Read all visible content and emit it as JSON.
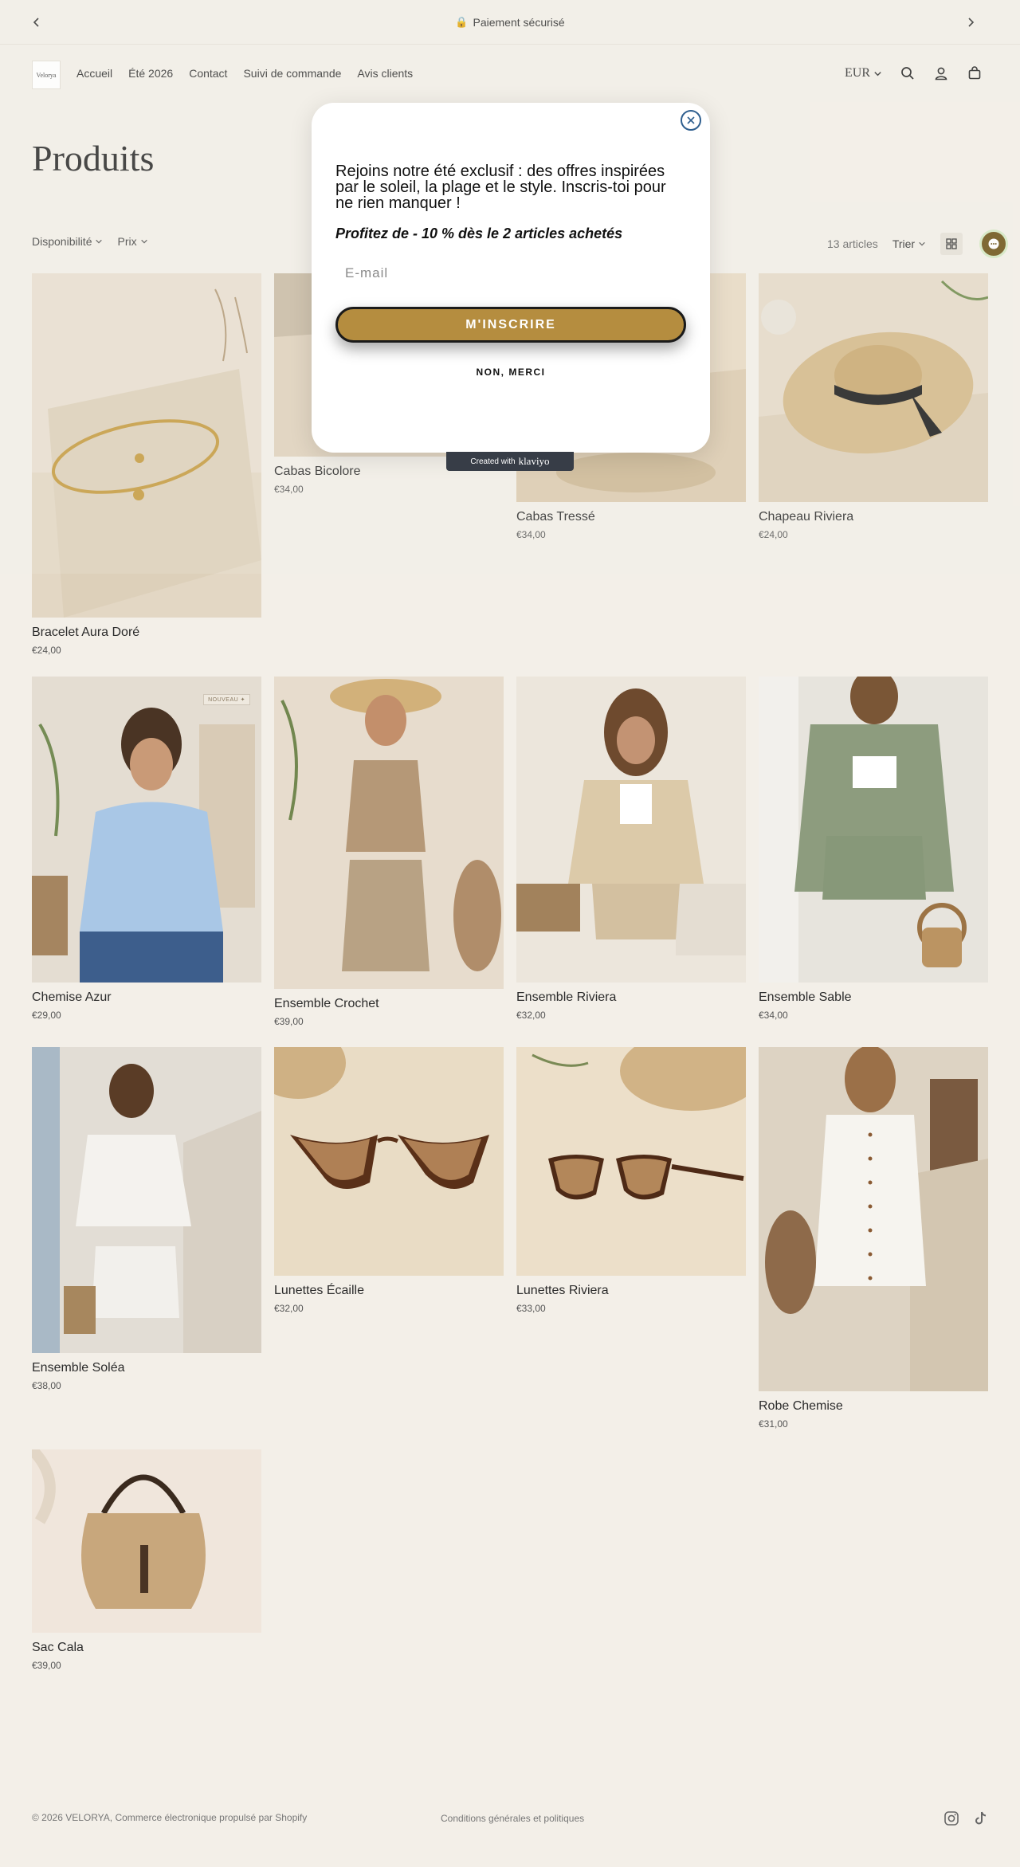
{
  "announcement": {
    "text": "Paiement sécurisé",
    "prev_icon": "chevron-left-icon",
    "next_icon": "chevron-right-icon",
    "lock_icon": "lock-icon"
  },
  "header": {
    "logo_text": "Velorya",
    "nav": [
      "Accueil",
      "Été 2026",
      "Contact",
      "Suivi de commande",
      "Avis clients"
    ],
    "currency": "EUR",
    "icons": [
      "search-icon",
      "account-icon",
      "cart-icon"
    ]
  },
  "page": {
    "title": "Produits"
  },
  "filters": {
    "availability": "Disponibilité",
    "price": "Prix",
    "count": "13 articles",
    "sort": "Trier"
  },
  "products": [
    {
      "name": "Bracelet Aura Doré",
      "price": "€24,00"
    },
    {
      "name": "Cabas Bicolore",
      "price": "€34,00"
    },
    {
      "name": "Cabas Tressé",
      "price": "€34,00"
    },
    {
      "name": "Chapeau Riviera",
      "price": "€24,00"
    },
    {
      "name": "Chemise Azur",
      "price": "€29,00",
      "badge": "NOUVEAU ✦"
    },
    {
      "name": "Ensemble Crochet",
      "price": "€39,00"
    },
    {
      "name": "Ensemble Riviera",
      "price": "€32,00"
    },
    {
      "name": "Ensemble Sable",
      "price": "€34,00"
    },
    {
      "name": "Ensemble Soléa",
      "price": "€38,00"
    },
    {
      "name": "Lunettes Écaille",
      "price": "€32,00"
    },
    {
      "name": "Lunettes Riviera",
      "price": "€33,00"
    },
    {
      "name": "Robe Chemise",
      "price": "€31,00"
    },
    {
      "name": "Sac Cala",
      "price": "€39,00"
    }
  ],
  "popup": {
    "heading": "Rejoins notre été exclusif : des offres inspirées par le soleil, la plage et le style. Inscris-toi pour ne rien manquer !",
    "offer": "Profitez de - 10 % dès le 2 articles achetés",
    "email_placeholder": "E-mail",
    "subscribe_label": "M'INSCRIRE",
    "decline_label": "NON, MERCI",
    "credit_prefix": "Created with",
    "credit_brand": "klaviyo",
    "button_color": "#b58d3f"
  },
  "footer": {
    "copyright": "© 2026 VELORYA, Commerce électronique propulsé par Shopify",
    "policies": "Conditions générales et politiques",
    "social_icons": [
      "instagram-icon",
      "tiktok-icon"
    ]
  }
}
